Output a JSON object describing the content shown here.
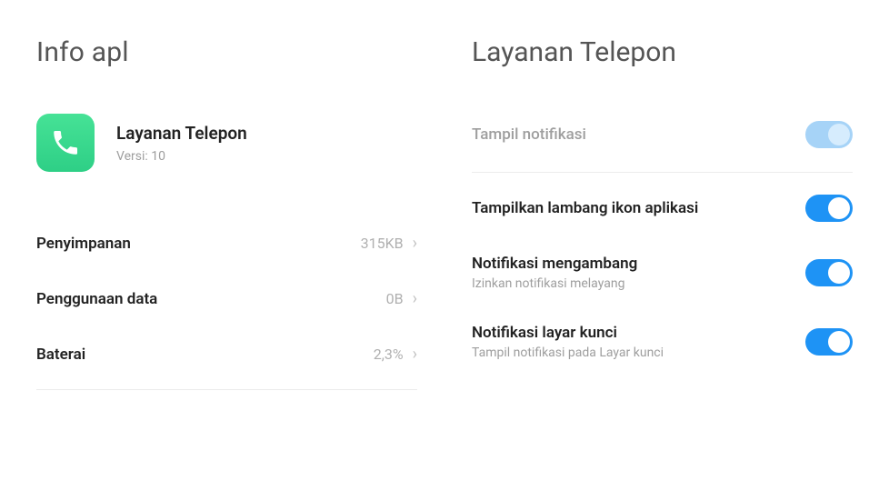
{
  "left": {
    "title": "Info apl",
    "app_name": "Layanan Telepon",
    "app_version": "Versi: 10",
    "rows": [
      {
        "label": "Penyimpanan",
        "value": "315KB"
      },
      {
        "label": "Penggunaan data",
        "value": "0B"
      },
      {
        "label": "Baterai",
        "value": "2,3%"
      }
    ]
  },
  "right": {
    "title": "Layanan Telepon",
    "notif_toggle": {
      "label": "Tampil notifikasi",
      "on": true,
      "disabled": true
    },
    "toggles": [
      {
        "label": "Tampilkan lambang ikon aplikasi",
        "sub": "",
        "on": true
      },
      {
        "label": "Notifikasi mengambang",
        "sub": "Izinkan notifikasi melayang",
        "on": true
      },
      {
        "label": "Notifikasi layar kunci",
        "sub": "Tampil notifikasi pada Layar kunci",
        "on": true
      }
    ]
  }
}
